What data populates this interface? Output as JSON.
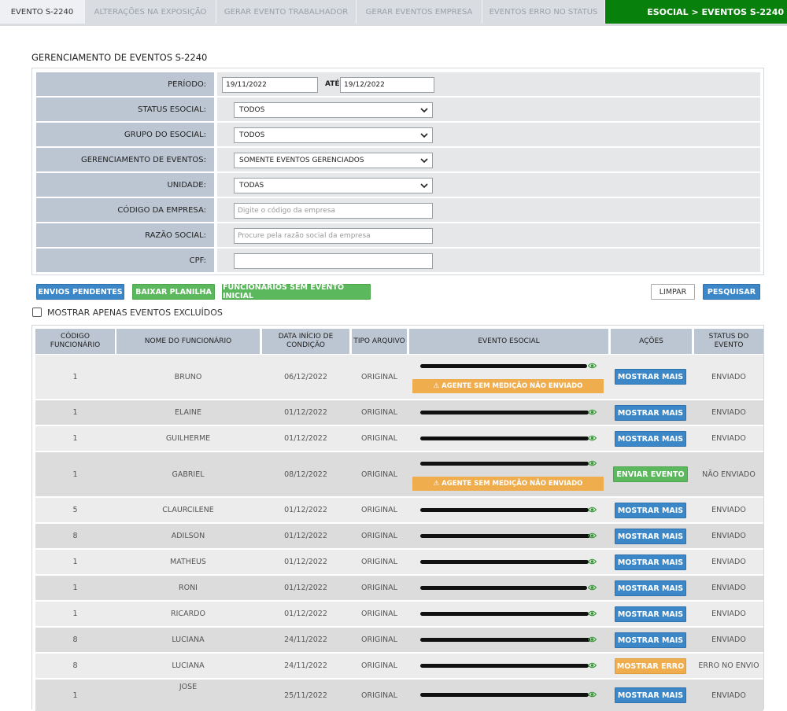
{
  "tabs": [
    {
      "label": "EVENTO S-2240"
    },
    {
      "label": "ALTERAÇÕES NA EXPOSIÇÃO"
    },
    {
      "label": "GERAR EVENTO TRABALHADOR"
    },
    {
      "label": "GERAR EVENTOS EMPRESA"
    },
    {
      "label": "EVENTOS ERRO NO STATUS"
    }
  ],
  "breadcrumb": "ESOCIAL > EVENTOS S-2240",
  "page_title": "GERENCIAMENTO DE EVENTOS S-2240",
  "filters": {
    "periodo_label": "PERÍODO:",
    "periodo_inicio": "19/11/2022",
    "ate_label": "ATÉ",
    "periodo_fim": "19/12/2022",
    "status_label": "STATUS ESOCIAL:",
    "status_value": "TODOS",
    "grupo_label": "GRUPO DO ESOCIAL:",
    "grupo_value": "TODOS",
    "gerenciamento_label": "GERENCIAMENTO DE EVENTOS:",
    "gerenciamento_value": "SOMENTE EVENTOS GERENCIADOS",
    "unidade_label": "UNIDADE:",
    "unidade_value": "TODAS",
    "codigo_label": "CÓDIGO DA EMPRESA:",
    "codigo_placeholder": "Digite o código da empresa",
    "razao_label": "RAZÃO SOCIAL:",
    "razao_placeholder": "Procure pela razão social da empresa",
    "cpf_label": "CPF:",
    "cpf_value": ""
  },
  "actions": {
    "envios_pendentes": "ENVIOS PENDENTES",
    "baixar_planilha": "BAIXAR PLANILHA",
    "sem_evento_inicial": "FUNCIONÁRIOS SEM EVENTO INICIAL",
    "limpar": "LIMPAR",
    "pesquisar": "PESQUISAR"
  },
  "show_deleted_label": "MOSTRAR APENAS EVENTOS EXCLUÍDOS",
  "table": {
    "headers": {
      "codigo": "CÓDIGO FUNCIONÁRIO",
      "nome": "NOME DO FUNCIONÁRIO",
      "data": "DATA INÍCIO DE CONDIÇÃO",
      "tipo": "TIPO ARQUIVO",
      "evento": "EVENTO ESOCIAL",
      "acoes": "AÇÕES",
      "status": "STATUS DO EVENTO"
    },
    "warning_text": "⚠ AGENTE SEM MEDIÇÃO NÃO ENVIADO",
    "rows": [
      {
        "codigo": "1",
        "nome": "BRUNO",
        "data": "06/12/2022",
        "tipo": "ORIGINAL",
        "acao": "MOSTRAR MAIS",
        "acao_color": "blue",
        "status": "ENVIADO",
        "warning": true
      },
      {
        "codigo": "1",
        "nome": "ELAINE",
        "data": "01/12/2022",
        "tipo": "ORIGINAL",
        "acao": "MOSTRAR MAIS",
        "acao_color": "blue",
        "status": "ENVIADO",
        "warning": false
      },
      {
        "codigo": "1",
        "nome": "GUILHERME",
        "data": "01/12/2022",
        "tipo": "ORIGINAL",
        "acao": "MOSTRAR MAIS",
        "acao_color": "blue",
        "status": "ENVIADO",
        "warning": false
      },
      {
        "codigo": "1",
        "nome": "GABRIEL",
        "data": "08/12/2022",
        "tipo": "ORIGINAL",
        "acao": "ENVIAR EVENTO",
        "acao_color": "green",
        "status": "NÃO ENVIADO",
        "warning": true
      },
      {
        "codigo": "5",
        "nome": "CLAURCILENE",
        "data": "01/12/2022",
        "tipo": "ORIGINAL",
        "acao": "MOSTRAR MAIS",
        "acao_color": "blue",
        "status": "ENVIADO",
        "warning": false
      },
      {
        "codigo": "8",
        "nome": "ADILSON",
        "data": "01/12/2022",
        "tipo": "ORIGINAL",
        "acao": "MOSTRAR MAIS",
        "acao_color": "blue",
        "status": "ENVIADO",
        "warning": false
      },
      {
        "codigo": "1",
        "nome": "MATHEUS",
        "data": "01/12/2022",
        "tipo": "ORIGINAL",
        "acao": "MOSTRAR MAIS",
        "acao_color": "blue",
        "status": "ENVIADO",
        "warning": false
      },
      {
        "codigo": "1",
        "nome": "RONI",
        "data": "01/12/2022",
        "tipo": "ORIGINAL",
        "acao": "MOSTRAR MAIS",
        "acao_color": "blue",
        "status": "ENVIADO",
        "warning": false
      },
      {
        "codigo": "1",
        "nome": "RICARDO",
        "data": "01/12/2022",
        "tipo": "ORIGINAL",
        "acao": "MOSTRAR MAIS",
        "acao_color": "blue",
        "status": "ENVIADO",
        "warning": false
      },
      {
        "codigo": "8",
        "nome": "LUCIANA",
        "data": "24/11/2022",
        "tipo": "ORIGINAL",
        "acao": "MOSTRAR MAIS",
        "acao_color": "blue",
        "status": "ENVIADO",
        "warning": false
      },
      {
        "codigo": "8",
        "nome": "LUCIANA",
        "data": "24/11/2022",
        "tipo": "ORIGINAL",
        "acao": "MOSTRAR ERRO",
        "acao_color": "orange",
        "status": "ERRO NO ENVIO",
        "warning": false
      },
      {
        "codigo": "1",
        "nome": "JOSE",
        "data": "25/11/2022",
        "tipo": "ORIGINAL",
        "acao": "MOSTRAR MAIS",
        "acao_color": "blue",
        "status": "ENVIADO",
        "warning": false
      }
    ]
  },
  "colors": {
    "accent_blue": "#3b87c8",
    "accent_green": "#5cb85c",
    "accent_orange": "#f0ad4e",
    "header_green": "#08800c"
  }
}
